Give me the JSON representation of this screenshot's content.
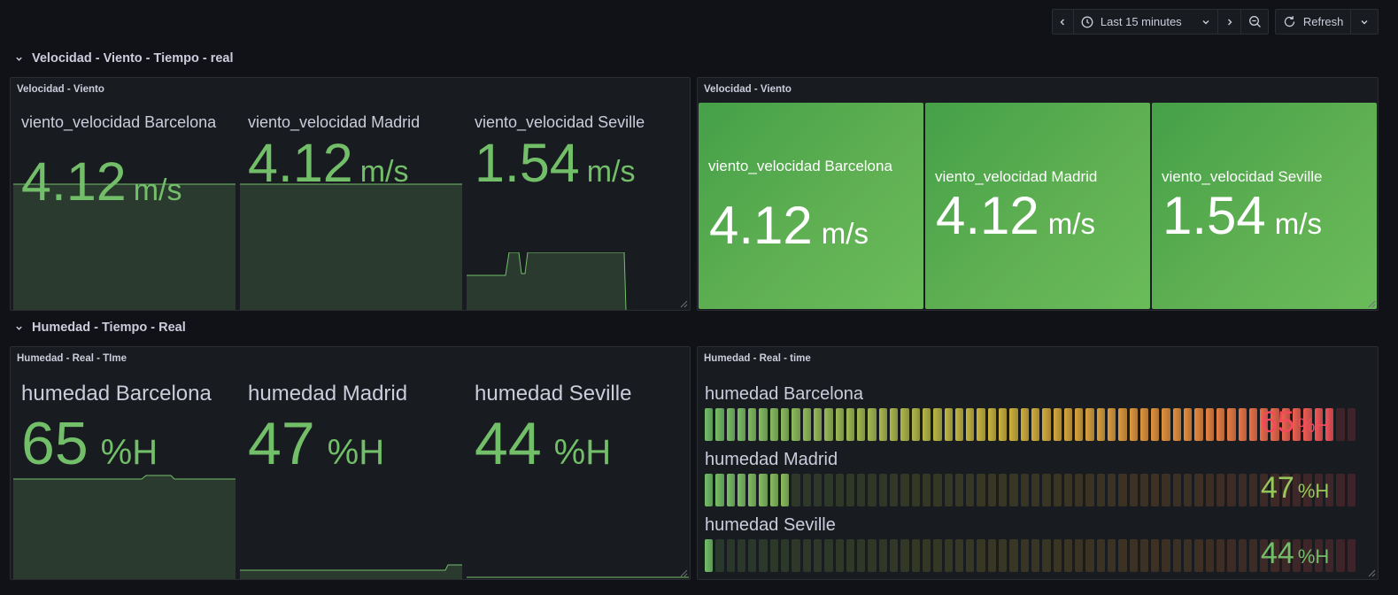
{
  "toolbar": {
    "time_range": "Last 15 minutes",
    "refresh_label": "Refresh"
  },
  "rows": [
    {
      "title": "Velocidad - Viento - Tiempo - real"
    },
    {
      "title": "Humedad - Tiempo - Real"
    }
  ],
  "panels": {
    "wind_sparkline": {
      "title": "Velocidad - Viento",
      "stats": [
        {
          "name": "viento_velocidad Barcelona",
          "value": "4.12",
          "unit": "m/s"
        },
        {
          "name": "viento_velocidad Madrid",
          "value": "4.12",
          "unit": "m/s"
        },
        {
          "name": "viento_velocidad Seville",
          "value": "1.54",
          "unit": "m/s"
        }
      ]
    },
    "wind_background": {
      "title": "Velocidad - Viento",
      "stats": [
        {
          "name": "viento_velocidad Barcelona",
          "value": "4.12",
          "unit": "m/s"
        },
        {
          "name": "viento_velocidad Madrid",
          "value": "4.12",
          "unit": "m/s"
        },
        {
          "name": "viento_velocidad Seville",
          "value": "1.54",
          "unit": "m/s"
        }
      ]
    },
    "humidity_stat": {
      "title": "Humedad - Real - TIme",
      "stats": [
        {
          "name": "humedad Barcelona",
          "value": "65",
          "unit": "%H"
        },
        {
          "name": "humedad Madrid",
          "value": "47",
          "unit": "%H"
        },
        {
          "name": "humedad Seville",
          "value": "44",
          "unit": "%H"
        }
      ]
    },
    "humidity_gauge": {
      "title": "Humedad - Real - time",
      "bars": [
        {
          "name": "humedad Barcelona",
          "value": "65",
          "unit": "%H",
          "fill_fraction": 0.967,
          "color": "#f2495c"
        },
        {
          "name": "humedad Madrid",
          "value": "47",
          "unit": "%H",
          "fill_fraction": 0.133,
          "color": "#96c85a"
        },
        {
          "name": "humedad Seville",
          "value": "44",
          "unit": "%H",
          "fill_fraction": 0.017,
          "color": "#73bf69"
        }
      ]
    }
  },
  "colors": {
    "background": "#111217",
    "panel": "#181b1f",
    "value_green": "#73bf69",
    "value_red": "#f2495c",
    "tile_green": "#56a64b"
  }
}
